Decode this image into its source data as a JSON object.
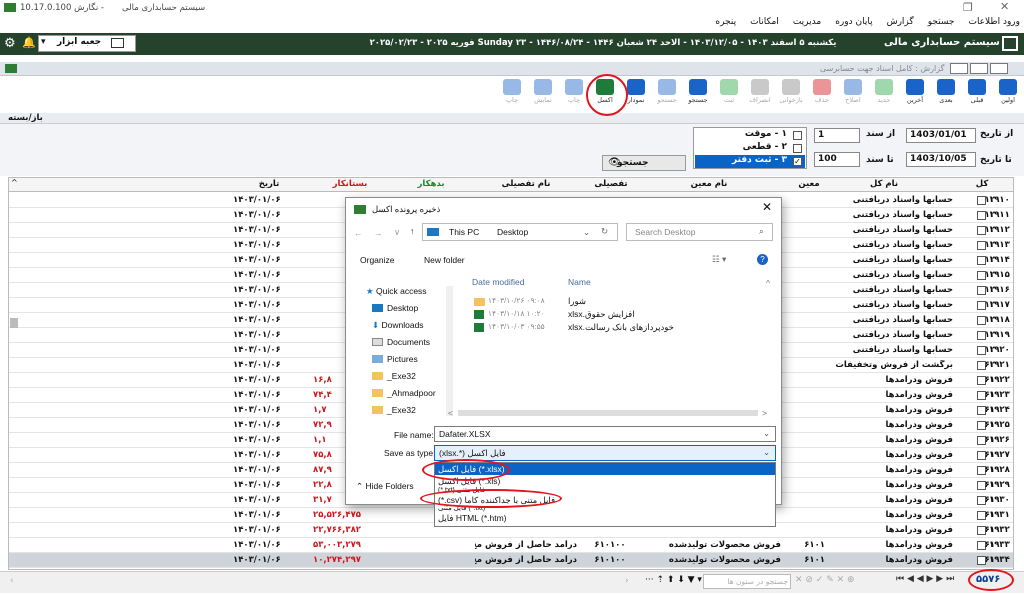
{
  "titlebar": {
    "title": "سیستم حسابداری مالی",
    "version": "نگارش 10.17.0.100 -"
  },
  "menu": [
    "ورود اطلاعات",
    "جستجو",
    "گزارش",
    "پایان دوره",
    "مدیریت",
    "امکانات",
    "پنجره"
  ],
  "greenbar": {
    "app": "سیستم حسابداری مالی",
    "date": "یکشنبه ۵ اسفند ۱۴۰۳ - ۱۴۰۳/۱۲/۰۵ - الاحد ۲۴ شعبان ۱۴۴۶ - ۱۴۴۶/۰۸/۲۴ - Sunday ۲۳ فوریه ۲۰۲۵ - ۲۰۲۵/۰۲/۲۳",
    "toolbox": "جعبه ابزار"
  },
  "doc_title": "گزارش : کامل اسناد جهت حسابرسی",
  "toolbar": [
    "اولین",
    "قبلی",
    "بعدی",
    "آخرین",
    "جدید",
    "اصلاح",
    "حذف",
    "بازخوانی",
    "انصراف",
    "ثبت",
    "جستجو",
    "جستجو",
    "نمودار",
    "اکسل",
    "چاپ",
    "نمایش",
    "چاپ"
  ],
  "section": "باز/بسته",
  "filters": {
    "from_date_label": "از تاریخ",
    "from_date": "1403/01/01",
    "to_date_label": "تا تاریخ",
    "to_date": "1403/10/05",
    "from_doc_label": "از سند",
    "from_doc": "1",
    "to_doc_label": "تا سند",
    "to_doc": "100",
    "opt1": "۱ - موقت",
    "opt2": "۲ - قطعی",
    "opt3": "۳ - ثبت دفتر",
    "search": "جستجو"
  },
  "grid": {
    "headers": [
      "کل",
      "نام کل",
      "معین",
      "نام معین",
      "تفصیلی",
      "نام تفصیلی",
      "بدهکار",
      "بستانکار",
      "تاریخ"
    ],
    "rows": [
      [
        "۱۹۱۰",
        "۱۲",
        "حسابها واسناد دریافتنی",
        "",
        "",
        "",
        "",
        "",
        "۱۴۰۳/۰۱/۰۶"
      ],
      [
        "۱۹۱۱",
        "۱۲",
        "حسابها واسناد دریافتنی",
        "",
        "",
        "",
        "",
        "",
        "۱۴۰۳/۰۱/۰۶"
      ],
      [
        "۱۹۱۲",
        "۱۲",
        "حسابها واسناد دریافتنی",
        "",
        "",
        "",
        "",
        "",
        "۱۴۰۳/۰۱/۰۶"
      ],
      [
        "۱۹۱۳",
        "۱۲",
        "حسابها واسناد دریافتنی",
        "",
        "",
        "",
        "",
        "",
        "۱۴۰۳/۰۱/۰۶"
      ],
      [
        "۱۹۱۴",
        "۱۲",
        "حسابها واسناد دریافتنی",
        "",
        "",
        "",
        "",
        "",
        "۱۴۰۳/۰۱/۰۶"
      ],
      [
        "۱۹۱۵",
        "۱۲",
        "حسابها واسناد دریافتنی",
        "",
        "",
        "",
        "",
        "",
        "۱۴۰۳/۰۱/۰۶"
      ],
      [
        "۱۹۱۶",
        "۱۲",
        "حسابها واسناد دریافتنی",
        "",
        "",
        "",
        "",
        "",
        "۱۴۰۳/۰۱/۰۶"
      ],
      [
        "۱۹۱۷",
        "۱۲",
        "حسابها واسناد دریافتنی",
        "",
        "",
        "",
        "",
        "",
        "۱۴۰۳/۰۱/۰۶"
      ],
      [
        "۱۹۱۸",
        "۱۲",
        "حسابها واسناد دریافتنی",
        "",
        "",
        "",
        "",
        "",
        "۱۴۰۳/۰۱/۰۶"
      ],
      [
        "۱۹۱۹",
        "۱۲",
        "حسابها واسناد دریافتنی",
        "",
        "",
        "",
        "",
        "",
        "۱۴۰۳/۰۱/۰۶"
      ],
      [
        "۱۹۲۰",
        "۱۲",
        "حسابها واسناد دریافتنی",
        "",
        "",
        "",
        "",
        "",
        "۱۴۰۳/۰۱/۰۶"
      ],
      [
        "۱۹۲۱",
        "۶۲",
        "برگشت از فروش وتخفیفات",
        "",
        "",
        "",
        "",
        "",
        "۱۴۰۳/۰۱/۰۶"
      ],
      [
        "۱۹۲۲",
        "۶۱",
        "فروش ودرآمدها",
        "",
        "",
        "",
        "",
        "۱۶,۸",
        "۱۴۰۳/۰۱/۰۶"
      ],
      [
        "۱۹۲۳",
        "۶۱",
        "فروش ودرآمدها",
        "",
        "",
        "",
        "",
        "۷۴,۴",
        "۱۴۰۳/۰۱/۰۶"
      ],
      [
        "۱۹۲۴",
        "۶۱",
        "فروش ودرآمدها",
        "",
        "",
        "",
        "",
        "۱,۷",
        "۱۴۰۳/۰۱/۰۶"
      ],
      [
        "۱۹۲۵",
        "۶۱",
        "فروش ودرآمدها",
        "",
        "",
        "",
        "",
        "۷۲,۹",
        "۱۴۰۳/۰۱/۰۶"
      ],
      [
        "۱۹۲۶",
        "۶۱",
        "فروش ودرآمدها",
        "",
        "",
        "",
        "",
        "۱,۱",
        "۱۴۰۳/۰۱/۰۶"
      ],
      [
        "۱۹۲۷",
        "۶۱",
        "فروش ودرآمدها",
        "",
        "",
        "",
        "",
        "۷۵,۸",
        "۱۴۰۳/۰۱/۰۶"
      ],
      [
        "۱۹۲۸",
        "۶۱",
        "فروش ودرآمدها",
        "",
        "",
        "",
        "",
        "۸۷,۹",
        "۱۴۰۳/۰۱/۰۶"
      ],
      [
        "۱۹۲۹",
        "۶۱",
        "فروش ودرآمدها",
        "",
        "",
        "",
        "",
        "۲۲,۸",
        "۱۴۰۳/۰۱/۰۶"
      ],
      [
        "۱۹۳۰",
        "۶۱",
        "فروش ودرآمدها",
        "",
        "",
        "",
        "",
        "۳۱,۷",
        "۱۴۰۳/۰۱/۰۶"
      ],
      [
        "۱۹۳۱",
        "۶۱",
        "فروش ودرآمدها",
        "",
        "",
        "",
        "",
        "۲۵,۵۲۶,۴۷۵",
        "۱۴۰۳/۰۱/۰۶"
      ],
      [
        "۱۹۳۲",
        "۶۱",
        "فروش ودرآمدها",
        "",
        "",
        "",
        "",
        "۲۲,۷۶۶,۳۸۲",
        "۱۴۰۳/۰۱/۰۶"
      ],
      [
        "۱۹۳۳",
        "۶۱",
        "فروش ودرآمدها",
        "۶۱۰۱",
        "فروش محصولات تولیدشده",
        "۶۱۰۱۰۰",
        "درآمد حاصل از فروش مح",
        "۵۳,۰۰۳,۲۷۹",
        "۱۴۰۳/۰۱/۰۶"
      ],
      [
        "۱۹۳۴",
        "۶۱",
        "فروش ودرآمدها",
        "۶۱۰۱",
        "فروش محصولات تولیدشده",
        "۶۱۰۱۰۰",
        "درآمد حاصل از فروش مح",
        "۱۰,۲۷۴,۲۹۷",
        "۱۴۰۳/۰۱/۰۶"
      ]
    ],
    "count": "۵۵۷۶",
    "search_placeholder": "جستجو در ستون ها"
  },
  "dialog": {
    "title": "ذخیره پرونده اکسل",
    "path": [
      "This PC",
      "Desktop"
    ],
    "search_placeholder": "Search Desktop",
    "organize": "Organize",
    "new_folder": "New folder",
    "nav": [
      "Quick access",
      "Desktop",
      "Downloads",
      "Documents",
      "Pictures",
      "_Exe32",
      "_Ahmadpoor",
      "_Exe32"
    ],
    "col_name": "Name",
    "col_date": "Date modified",
    "files": [
      {
        "name": "شورا",
        "date": "۱۴۰۳/۱۰/۲۶ ۰۹:۰۸"
      },
      {
        "name": "افزایش حقوق.xlsx",
        "date": "۱۴۰۳/۱۰/۱۸ ۱۰:۲۰"
      },
      {
        "name": "خودپردازهای بانک رسالت.xlsx",
        "date": "۱۴۰۳/۱۰/۰۳ ۰۹:۵۵"
      }
    ],
    "filename_label": "File name:",
    "filename": "Dafater.XLSX",
    "savetype_label": "Save as type:",
    "savetype": "فایل اکسل (*.xlsx)",
    "options": [
      "فایل اکسل (*.xlsx)",
      "فایل اکسل (*.xls)",
      "(*.txt) فایل متنی",
      "(*.csv) فایل متنی با جداکننده کاما",
      "فایل متنی (*.txt)",
      "فایل HTML (*.htm)"
    ],
    "hide_folders": "Hide Folders"
  },
  "colors": {
    "accent": "#25422c",
    "credit": "#d0161c",
    "debit": "#1a8a2e",
    "highlight": "#e3141d"
  }
}
